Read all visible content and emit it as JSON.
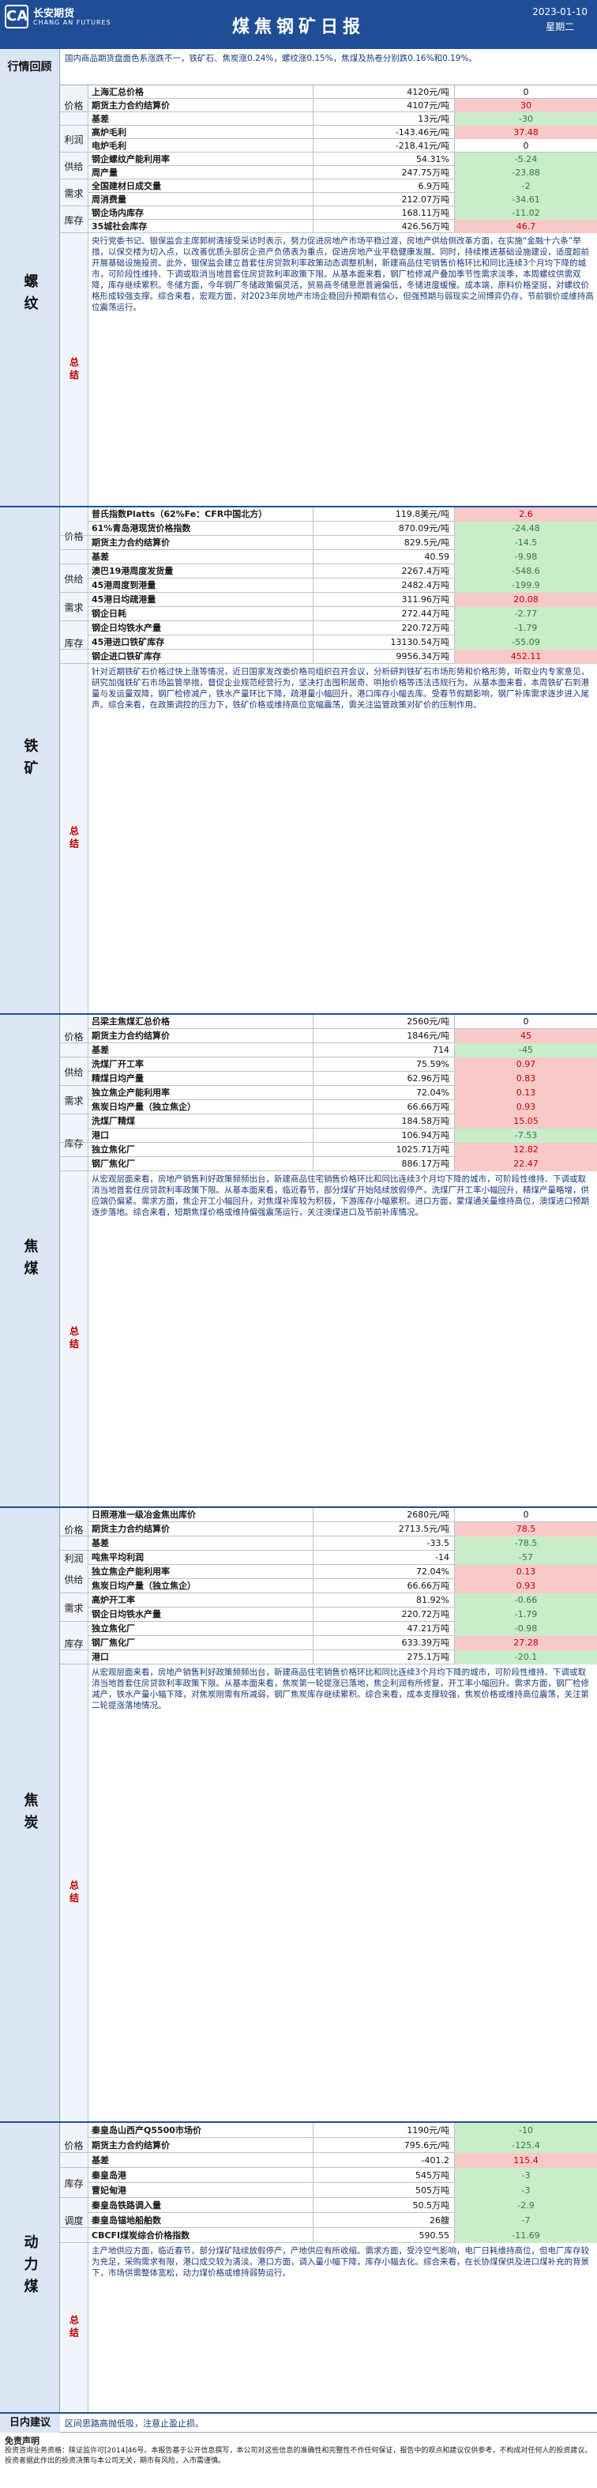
{
  "header": {
    "logo_cn": "长安期货",
    "logo_en": "CHANG AN FUTURES",
    "title": "煤焦钢矿日报",
    "date": "2023-01-10",
    "weekday": "星期二"
  },
  "review": {
    "label": "行情回顾",
    "text": "国内商品期货盘面色系涨跌不一，铁矿石、焦炭涨0.24%，螺纹涨0.15%，焦煤及热卷分别跌0.16%和0.19%。"
  },
  "sections": [
    {
      "name": "螺纹",
      "rows": [
        {
          "cat": "价格",
          "label": "上海汇总价格",
          "value": "4120元/吨",
          "change": "0"
        },
        {
          "cat": "",
          "label": "期货主力合约结算价",
          "value": "4107元/吨",
          "change": "30"
        },
        {
          "cat": "",
          "label": "基差",
          "value": "13元/吨",
          "change": "-30"
        },
        {
          "cat": "利润",
          "label": "高炉毛利",
          "value": "-143.46元/吨",
          "change": "37.48"
        },
        {
          "cat": "",
          "label": "电炉毛利",
          "value": "-218.41元/吨",
          "change": "0"
        },
        {
          "cat": "供给",
          "label": "钢企螺纹产能利用率",
          "value": "54.31%",
          "change": "-5.24"
        },
        {
          "cat": "",
          "label": "周产量",
          "value": "247.75万吨",
          "change": "-23.88"
        },
        {
          "cat": "需求",
          "label": "全国建材日成交量",
          "value": "6.9万吨",
          "change": "-2"
        },
        {
          "cat": "",
          "label": "周消费量",
          "value": "212.07万吨",
          "change": "-34.61"
        },
        {
          "cat": "库存",
          "label": "钢企场内库存",
          "value": "168.11万吨",
          "change": "-11.02"
        },
        {
          "cat": "",
          "label": "35城社会库存",
          "value": "426.56万吨",
          "change": "46.7"
        }
      ],
      "summary": "央行党委书记、银保监会主席郭树清接受采访时表示，努力促进房地产市场平稳过渡，房地产供给侧改革方面，在实施“金融十六条”举措，以保交楼为切入点，以改善优质头部房企资产负债表为重点，促进房地产业平稳健康发展。同时，持续推进基础设施建设，适度超前开展基础设施投资。此外，银保监会建立首套住房贷款利率政策动态调整机制，新建商品住宅销售价格环比和同比连续3个月均下降的城市，可阶段性维持、下调或取消当地首套住房贷款利率政策下限。从基本面来看，钢厂检修减产叠加季节性需求淡季，本周螺纹供需双降，库存继续累积。冬储方面，今年钢厂冬储政策偏灵活，贸易商冬储意愿普遍偏低，冬储进度缓慢。成本端，原料价格坚挺，对螺纹价格形成较强支撑。综合来看，宏观方面，对2023年房地产市场企稳回升预期有信心，但强预期与弱现实之间博弈仍存，节前钢价或维持高位震荡运行。"
    },
    {
      "name": "铁矿",
      "rows": [
        {
          "cat": "价格",
          "label": "普氏指数Platts（62%Fe：CFR中国北方）",
          "value": "119.8美元/吨",
          "change": "2.6"
        },
        {
          "cat": "",
          "label": "61%青岛港现货价格指数",
          "value": "870.09元/吨",
          "change": "-24.48"
        },
        {
          "cat": "",
          "label": "期货主力合约结算价",
          "value": "829.5元/吨",
          "change": "-14.5"
        },
        {
          "cat": "",
          "label": "基差",
          "value": "40.59",
          "change": "-9.98"
        },
        {
          "cat": "供给",
          "label": "澳巴19港周度发货量",
          "value": "2267.4万吨",
          "change": "-548.6"
        },
        {
          "cat": "",
          "label": "45港周度到港量",
          "value": "2482.4万吨",
          "change": "-199.9"
        },
        {
          "cat": "需求",
          "label": "45港日均疏港量",
          "value": "311.96万吨",
          "change": "20.08"
        },
        {
          "cat": "",
          "label": "钢企日耗",
          "value": "272.44万吨",
          "change": "-2.77"
        },
        {
          "cat": "库存",
          "label": "钢企日均铁水产量",
          "value": "220.72万吨",
          "change": "-1.79"
        },
        {
          "cat": "",
          "label": "45港进口铁矿库存",
          "value": "13130.54万吨",
          "change": "-55.09"
        },
        {
          "cat": "",
          "label": "钢企进口铁矿库存",
          "value": "9956.34万吨",
          "change": "452.11"
        }
      ],
      "summary": "针对近期铁矿石价格过快上涨等情况，近日国家发改委价格司组织召开会议，分析研判铁矿石市场形势和价格形势，听取业内专家意见，研究加强铁矿石市场监管举措，督促企业规范经营行为，坚决打击囤积居奇、哄抬价格等违法违规行为。从基本面来看，本周铁矿石到港量与发运量双降，钢厂检修减产，铁水产量环比下降，疏港量小幅回升，港口库存小幅去库。受春节假期影响，钢厂补库需求逐步进入尾声。综合来看，在政策调控的压力下，铁矿价格或维持高位宽幅震荡，需关注监管政策对矿价的压制作用。"
    },
    {
      "name": "焦煤",
      "rows": [
        {
          "cat": "价格",
          "label": "吕梁主焦煤汇总价格",
          "value": "2560元/吨",
          "change": "0"
        },
        {
          "cat": "",
          "label": "期货主力合约结算价",
          "value": "1846元/吨",
          "change": "45"
        },
        {
          "cat": "",
          "label": "基差",
          "value": "714",
          "change": "-45"
        },
        {
          "cat": "供给",
          "label": "洗煤厂开工率",
          "value": "75.59%",
          "change": "0.97"
        },
        {
          "cat": "",
          "label": "精煤日均产量",
          "value": "62.96万吨",
          "change": "0.83"
        },
        {
          "cat": "需求",
          "label": "独立焦企产能利用率",
          "value": "72.04%",
          "change": "0.13"
        },
        {
          "cat": "",
          "label": "焦炭日均产量（独立焦企）",
          "value": "66.66万吨",
          "change": "0.93"
        },
        {
          "cat": "库存",
          "label": "洗煤厂精煤",
          "value": "184.58万吨",
          "change": "15.05"
        },
        {
          "cat": "",
          "label": "港口",
          "value": "106.94万吨",
          "change": "-7.53"
        },
        {
          "cat": "",
          "label": "独立焦化厂",
          "value": "1025.71万吨",
          "change": "12.82"
        },
        {
          "cat": "",
          "label": "钢厂焦化厂",
          "value": "886.17万吨",
          "change": "22.47"
        }
      ],
      "summary": "从宏观层面来看，房地产销售利好政策频频出台，新建商品住宅销售价格环比和同比连续3个月均下降的城市，可阶段性维持、下调或取消当地首套住房贷款利率政策下限。从基本面来看，临近春节，部分煤矿开始陆续放假停产，洗煤厂开工率小幅回升，精煤产量略增，供应端仍偏紧。需求方面，焦企开工小幅回升，对焦煤补库较为积极，下游库存小幅累积。进口方面，蒙煤通关量维持高位，澳煤进口预期逐步落地。综合来看，短期焦煤价格或维持偏强震荡运行，关注澳煤进口及节前补库情况。"
    },
    {
      "name": "焦炭",
      "rows": [
        {
          "cat": "价格",
          "label": "日照港准一级冶金焦出库价",
          "value": "2680元/吨",
          "change": "0"
        },
        {
          "cat": "",
          "label": "期货主力合约结算价",
          "value": "2713.5元/吨",
          "change": "78.5"
        },
        {
          "cat": "",
          "label": "基差",
          "value": "-33.5",
          "change": "-78.5"
        },
        {
          "cat": "利润",
          "label": "吨焦平均利润",
          "value": "-14",
          "change": "-57"
        },
        {
          "cat": "供给",
          "label": "独立焦企产能利用率",
          "value": "72.04%",
          "change": "0.13"
        },
        {
          "cat": "",
          "label": "焦炭日均产量（独立焦企）",
          "value": "66.66万吨",
          "change": "0.93"
        },
        {
          "cat": "需求",
          "label": "高炉开工率",
          "value": "81.92%",
          "change": "-0.66"
        },
        {
          "cat": "",
          "label": "钢企日均铁水产量",
          "value": "220.72万吨",
          "change": "-1.79"
        },
        {
          "cat": "库存",
          "label": "独立焦化厂",
          "value": "47.21万吨",
          "change": "-0.98"
        },
        {
          "cat": "",
          "label": "钢厂焦化厂",
          "value": "633.39万吨",
          "change": "27.28"
        },
        {
          "cat": "",
          "label": "港口",
          "value": "275.1万吨",
          "change": "-20.1"
        }
      ],
      "summary": "从宏观层面来看，房地产销售利好政策频频出台，新建商品住宅销售价格环比和同比连续3个月均下降的城市，可阶段性维持、下调或取消当地首套住房贷款利率政策下限。从基本面来看，焦炭第一轮提涨已落地，焦企利润有所修复，开工率小幅回升。需求方面，钢厂检修减产，铁水产量小幅下降，对焦炭刚需有所减弱，钢厂焦炭库存继续累积。综合来看，成本支撑较强，焦炭价格或维持高位震荡，关注第二轮提涨落地情况。"
    },
    {
      "name": "动力煤",
      "rows": [
        {
          "cat": "价格",
          "label": "秦皇岛山西产Q5500市场价",
          "value": "1190元/吨",
          "change": "-10"
        },
        {
          "cat": "",
          "label": "期货主力合约结算价",
          "value": "795.6元/吨",
          "change": "-125.4"
        },
        {
          "cat": "",
          "label": "基差",
          "value": "-401.2",
          "change": "115.4"
        },
        {
          "cat": "库存",
          "label": "秦皇岛港",
          "value": "545万吨",
          "change": "-3"
        },
        {
          "cat": "",
          "label": "曹妃甸港",
          "value": "505万吨",
          "change": "-3"
        },
        {
          "cat": "调度",
          "label": "秦皇岛铁路调入量",
          "value": "50.5万吨",
          "change": "-2.9"
        },
        {
          "cat": "",
          "label": "秦皇岛锚地船舶数",
          "value": "26艘",
          "change": "-7"
        },
        {
          "cat": "",
          "label": "CBCFI煤炭综合价格指数",
          "value": "590.55",
          "change": "-11.69"
        }
      ],
      "summary": "主产地供应方面，临近春节，部分煤矿陆续放假停产，产地供应有所收缩。需求方面，受冷空气影响，电厂日耗维持高位，但电厂库存较为充足，采购需求有限，港口成交较为清淡。港口方面，调入量小幅下降，库存小幅去化。综合来看，在长协煤保供及进口煤补充的背景下，市场供需整体宽松，动力煤价格或维持弱势运行。"
    }
  ],
  "bottom": {
    "label": "日内建议",
    "text": "区间思路高抛低吸，注意止盈止损。"
  },
  "disclaimer": {
    "title": "免责声明",
    "text": "投资咨询业务资格：陕证监许可[2014]46号。本报告基于公开信息撰写，本公司对这些信息的准确性和完整性不作任何保证，报告中的观点和建议仅供参考，不构成对任何人的投资建议。投资者据此作出的投资决策与本公司无关，期市有风险，入市需谨慎。"
  },
  "colors": {
    "accent": "#1f4e96",
    "up": "#c00000",
    "down": "#2e7d32",
    "up_bg": "#f8c9c9",
    "down_bg": "#c9ecc9"
  }
}
